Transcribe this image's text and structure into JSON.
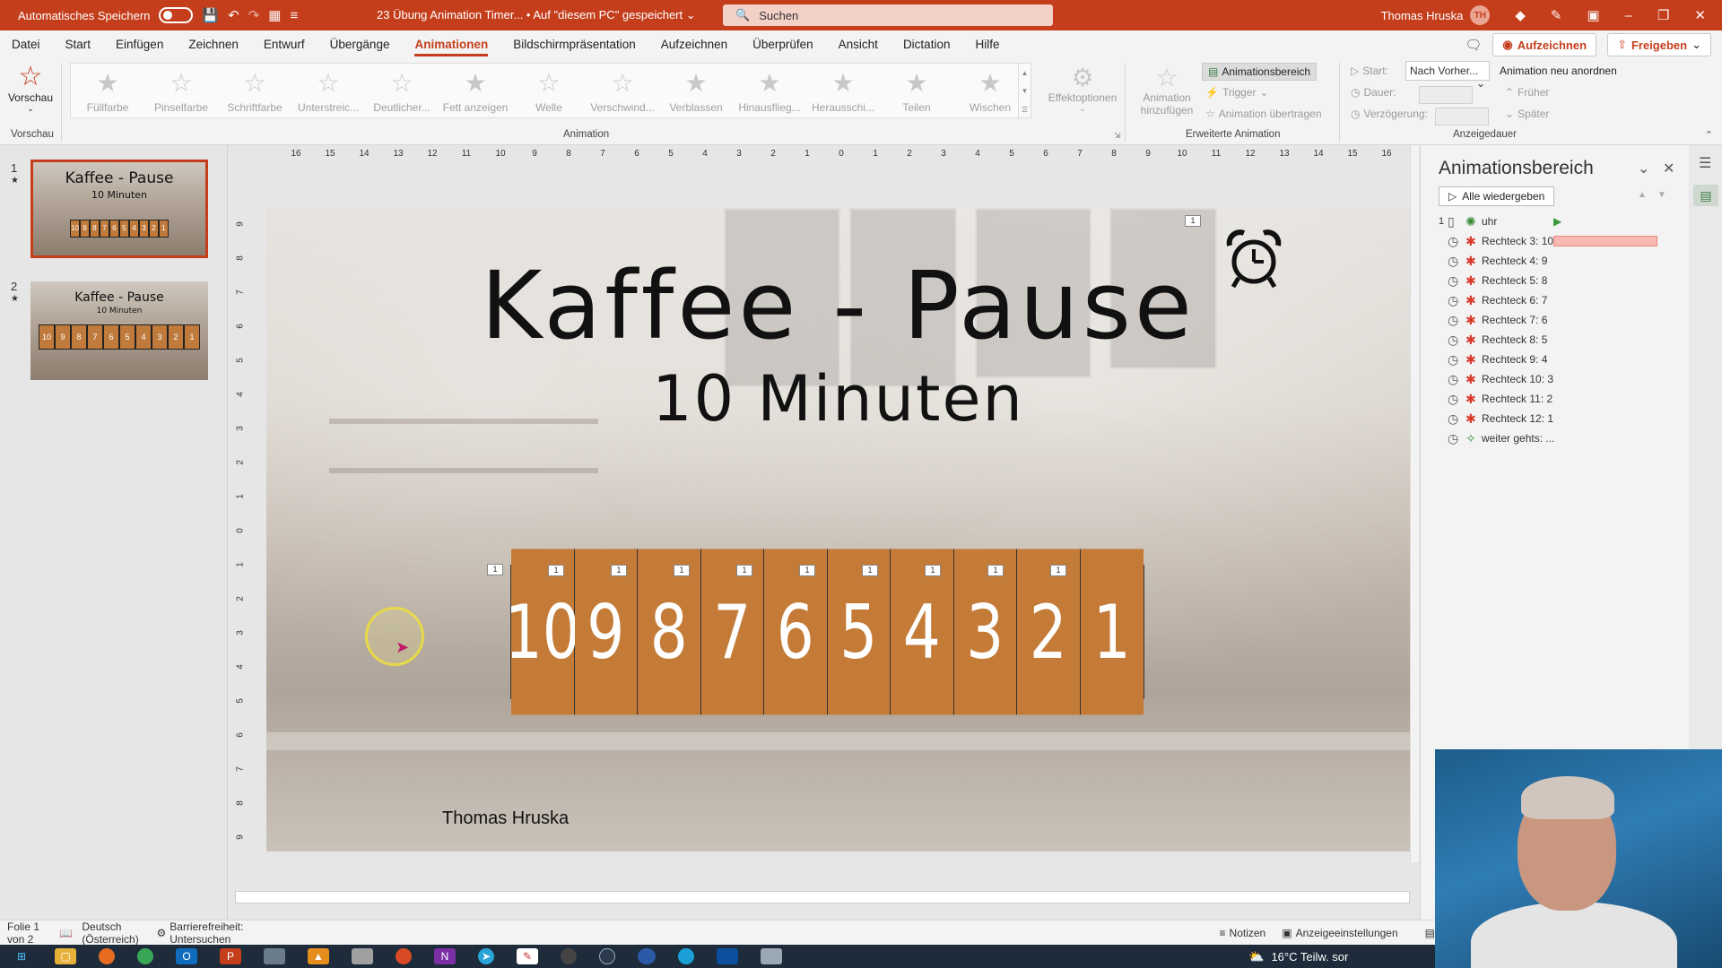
{
  "titlebar": {
    "autosave_label": "Automatisches Speichern",
    "doc_title": "23 Übung Animation Timer... • Auf \"diesem PC\" gespeichert",
    "search_placeholder": "Suchen",
    "user_name": "Thomas Hruska",
    "user_initials": "TH"
  },
  "menu": {
    "tabs": [
      "Datei",
      "Start",
      "Einfügen",
      "Zeichnen",
      "Entwurf",
      "Übergänge",
      "Animationen",
      "Bildschirmpräsentation",
      "Aufzeichnen",
      "Überprüfen",
      "Ansicht",
      "Dictation",
      "Hilfe"
    ],
    "active_tab": "Animationen",
    "record_btn": "Aufzeichnen",
    "share_btn": "Freigeben"
  },
  "ribbon": {
    "preview_label": "Vorschau",
    "preview_group": "Vorschau",
    "animation_group": "Animation",
    "animations": [
      "Füllfarbe",
      "Pinselfarbe",
      "Schriftfarbe",
      "Unterstreic...",
      "Deutlicher...",
      "Fett anzeigen",
      "Welle",
      "Verschwind...",
      "Verblassen",
      "Hinausflieg...",
      "Herausschi...",
      "Teilen",
      "Wischen"
    ],
    "effect_options": "Effektoptionen",
    "add_animation_1": "Animation",
    "add_animation_2": "hinzufügen",
    "anim_pane_btn": "Animationsbereich",
    "trigger": "Trigger",
    "copy_anim": "Animation übertragen",
    "advanced_group": "Erweiterte Animation",
    "start_label": "Start:",
    "start_value": "Nach Vorher...",
    "duration_label": "Dauer:",
    "delay_label": "Verzögerung:",
    "reorder_label": "Animation neu anordnen",
    "earlier": "Früher",
    "later": "Später",
    "timing_group": "Anzeigedauer"
  },
  "slides_pane": {
    "slides": [
      {
        "num": "1",
        "title": "Kaffee - Pause",
        "subtitle": "10 Minuten"
      },
      {
        "num": "2",
        "title": "Kaffee - Pause",
        "subtitle": "10 Minuten"
      }
    ],
    "thumb_cells": [
      "10",
      "9",
      "8",
      "7",
      "6",
      "5",
      "4",
      "3",
      "2",
      "1"
    ]
  },
  "ruler": {
    "h_ticks": [
      "16",
      "15",
      "14",
      "13",
      "12",
      "11",
      "10",
      "9",
      "8",
      "7",
      "6",
      "5",
      "4",
      "3",
      "2",
      "1",
      "0",
      "1",
      "2",
      "3",
      "4",
      "5",
      "6",
      "7",
      "8",
      "9",
      "10",
      "11",
      "12",
      "13",
      "14",
      "15",
      "16"
    ],
    "v_ticks": [
      "9",
      "8",
      "7",
      "6",
      "5",
      "4",
      "3",
      "2",
      "1",
      "0",
      "1",
      "2",
      "3",
      "4",
      "5",
      "6",
      "7",
      "8",
      "9"
    ]
  },
  "slide": {
    "title": "Kaffee - Pause",
    "subtitle": "10 Minuten",
    "countdown": [
      "10",
      "9",
      "8",
      "7",
      "6",
      "5",
      "4",
      "3",
      "2",
      "1"
    ],
    "tag_label": "1",
    "author": "Thomas Hruska"
  },
  "anim_pane": {
    "title": "Animationsbereich",
    "play_all": "Alle wiedergeben",
    "items": [
      {
        "num": "1",
        "label": "uhr",
        "type": "green"
      },
      {
        "num": "",
        "label": "Rechteck 3: 10",
        "type": "red"
      },
      {
        "num": "",
        "label": "Rechteck 4: 9",
        "type": "red"
      },
      {
        "num": "",
        "label": "Rechteck 5: 8",
        "type": "red"
      },
      {
        "num": "",
        "label": "Rechteck 6: 7",
        "type": "red"
      },
      {
        "num": "",
        "label": "Rechteck 7: 6",
        "type": "red"
      },
      {
        "num": "",
        "label": "Rechteck 8: 5",
        "type": "red"
      },
      {
        "num": "",
        "label": "Rechteck 9: 4",
        "type": "red"
      },
      {
        "num": "",
        "label": "Rechteck 10: 3",
        "type": "red"
      },
      {
        "num": "",
        "label": "Rechteck 11: 2",
        "type": "red"
      },
      {
        "num": "",
        "label": "Rechteck 12: 1",
        "type": "red"
      },
      {
        "num": "",
        "label": "weiter gehts: ...",
        "type": "green"
      }
    ]
  },
  "statusbar": {
    "slide_info": "Folie 1 von 2",
    "language": "Deutsch (Österreich)",
    "accessibility": "Barrierefreiheit: Untersuchen",
    "notes": "Notizen",
    "display_settings": "Anzeigeeinstellungen"
  },
  "taskbar": {
    "weather": "16°C  Teilw. sor"
  },
  "colors": {
    "accent": "#c43e1c",
    "countdown_cell": "#c47b37"
  }
}
